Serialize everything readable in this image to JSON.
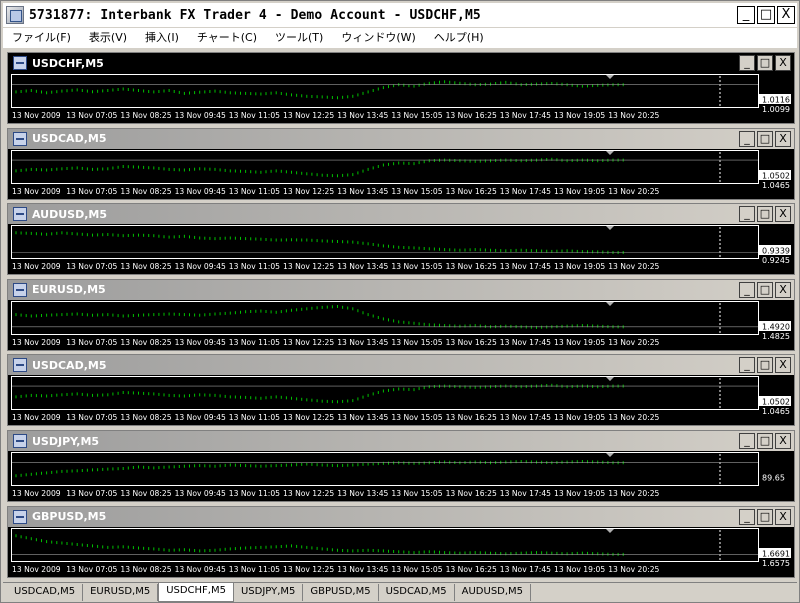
{
  "window": {
    "title": "5731877: Interbank FX Trader 4 - Demo Account - USDCHF,M5",
    "minimize_label": "_",
    "maximize_label": "□",
    "close_label": "X"
  },
  "menu": [
    {
      "label": "ファイル(F)"
    },
    {
      "label": "表示(V)"
    },
    {
      "label": "挿入(I)"
    },
    {
      "label": "チャート(C)"
    },
    {
      "label": "ツール(T)"
    },
    {
      "label": "ウィンドウ(W)"
    },
    {
      "label": "ヘルプ(H)"
    }
  ],
  "time_labels": [
    "13 Nov 2009",
    "13 Nov 07:05",
    "13 Nov 08:25",
    "13 Nov 09:45",
    "13 Nov 11:05",
    "13 Nov 12:25",
    "13 Nov 13:45",
    "13 Nov 15:05",
    "13 Nov 16:25",
    "13 Nov 17:45",
    "13 Nov 19:05",
    "13 Nov 20:25"
  ],
  "charts": [
    {
      "title": "USDCHF,M5",
      "active": true,
      "price_high": "1.0116",
      "price_low": "1.0099",
      "trend": [
        0.45,
        0.5,
        0.42,
        0.48,
        0.52,
        0.46,
        0.5,
        0.55,
        0.5,
        0.45,
        0.5,
        0.4,
        0.44,
        0.48,
        0.42,
        0.4,
        0.38,
        0.42,
        0.35,
        0.3,
        0.28,
        0.25,
        0.3,
        0.45,
        0.6,
        0.7,
        0.65,
        0.75,
        0.8,
        0.75,
        0.7,
        0.72,
        0.78,
        0.7,
        0.72,
        0.74,
        0.7,
        0.65,
        0.68,
        0.7
      ]
    },
    {
      "title": "USDCAD,M5",
      "active": false,
      "price_high": "1.0502",
      "price_low": "1.0465",
      "trend": [
        0.35,
        0.4,
        0.38,
        0.42,
        0.45,
        0.4,
        0.42,
        0.5,
        0.48,
        0.45,
        0.4,
        0.38,
        0.42,
        0.4,
        0.35,
        0.33,
        0.3,
        0.35,
        0.3,
        0.25,
        0.2,
        0.18,
        0.22,
        0.4,
        0.55,
        0.62,
        0.6,
        0.7,
        0.72,
        0.7,
        0.68,
        0.7,
        0.72,
        0.7,
        0.72,
        0.75,
        0.7,
        0.72,
        0.7,
        0.72
      ]
    },
    {
      "title": "AUDUSD,M5",
      "active": false,
      "price_high": "0.9339",
      "price_low": "0.9245",
      "trend": [
        0.8,
        0.78,
        0.75,
        0.8,
        0.76,
        0.72,
        0.74,
        0.7,
        0.72,
        0.7,
        0.65,
        0.68,
        0.62,
        0.6,
        0.62,
        0.6,
        0.58,
        0.55,
        0.56,
        0.55,
        0.52,
        0.5,
        0.48,
        0.42,
        0.35,
        0.3,
        0.28,
        0.25,
        0.22,
        0.2,
        0.22,
        0.2,
        0.18,
        0.2,
        0.18,
        0.16,
        0.18,
        0.15,
        0.14,
        0.12
      ]
    },
    {
      "title": "EURUSD,M5",
      "active": false,
      "price_high": "1.4920",
      "price_low": "1.4825",
      "trend": [
        0.6,
        0.55,
        0.58,
        0.6,
        0.62,
        0.58,
        0.6,
        0.55,
        0.58,
        0.6,
        0.62,
        0.6,
        0.58,
        0.62,
        0.65,
        0.7,
        0.72,
        0.68,
        0.75,
        0.8,
        0.85,
        0.88,
        0.8,
        0.6,
        0.45,
        0.35,
        0.3,
        0.25,
        0.22,
        0.2,
        0.22,
        0.18,
        0.2,
        0.18,
        0.16,
        0.18,
        0.2,
        0.22,
        0.2,
        0.18
      ]
    },
    {
      "title": "USDCAD,M5",
      "active": false,
      "price_high": "1.0502",
      "price_low": "1.0465",
      "trend": [
        0.35,
        0.4,
        0.38,
        0.42,
        0.45,
        0.4,
        0.42,
        0.5,
        0.48,
        0.45,
        0.4,
        0.38,
        0.42,
        0.4,
        0.35,
        0.33,
        0.3,
        0.35,
        0.3,
        0.25,
        0.2,
        0.18,
        0.22,
        0.4,
        0.55,
        0.62,
        0.6,
        0.7,
        0.72,
        0.7,
        0.68,
        0.7,
        0.72,
        0.7,
        0.72,
        0.75,
        0.7,
        0.72,
        0.7,
        0.72
      ]
    },
    {
      "title": "USDJPY,M5",
      "active": false,
      "price_high": "",
      "price_low": "89.65",
      "trend": [
        0.25,
        0.3,
        0.35,
        0.4,
        0.42,
        0.45,
        0.48,
        0.5,
        0.55,
        0.52,
        0.55,
        0.58,
        0.6,
        0.58,
        0.62,
        0.6,
        0.58,
        0.6,
        0.62,
        0.65,
        0.62,
        0.6,
        0.62,
        0.65,
        0.68,
        0.7,
        0.68,
        0.7,
        0.72,
        0.7,
        0.72,
        0.7,
        0.72,
        0.74,
        0.72,
        0.7,
        0.72,
        0.74,
        0.72,
        0.7
      ]
    },
    {
      "title": "GBPUSD,M5",
      "active": false,
      "price_high": "1.6691",
      "price_low": "1.6575",
      "trend": [
        0.8,
        0.7,
        0.6,
        0.55,
        0.5,
        0.45,
        0.4,
        0.42,
        0.38,
        0.35,
        0.3,
        0.32,
        0.28,
        0.3,
        0.35,
        0.38,
        0.4,
        0.42,
        0.45,
        0.4,
        0.35,
        0.3,
        0.28,
        0.3,
        0.28,
        0.25,
        0.22,
        0.25,
        0.22,
        0.2,
        0.22,
        0.2,
        0.18,
        0.2,
        0.22,
        0.2,
        0.18,
        0.2,
        0.18,
        0.16
      ]
    }
  ],
  "tabs": [
    {
      "label": "USDCAD,M5",
      "active": false
    },
    {
      "label": "EURUSD,M5",
      "active": false
    },
    {
      "label": "USDCHF,M5",
      "active": true
    },
    {
      "label": "USDJPY,M5",
      "active": false
    },
    {
      "label": "GBPUSD,M5",
      "active": false
    },
    {
      "label": "USDCAD,M5",
      "active": false
    },
    {
      "label": "AUDUSD,M5",
      "active": false
    }
  ],
  "colors": {
    "candle": "#00c000",
    "axis": "#ffffff",
    "plot_bg": "#000000"
  }
}
